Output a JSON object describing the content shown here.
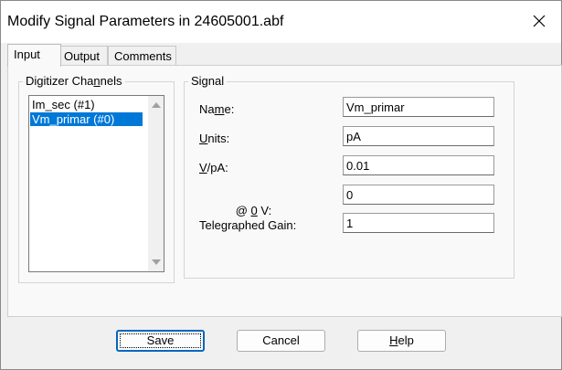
{
  "window": {
    "title": "Modify Signal Parameters in 24605001.abf",
    "close_glyph": "✕"
  },
  "tabs": [
    {
      "label": "Input",
      "active": true
    },
    {
      "label": "Output",
      "active": false
    },
    {
      "label": "Comments",
      "active": false
    }
  ],
  "channels": {
    "group_label_pre": "Digitizer Cha",
    "group_label_accel": "n",
    "group_label_post": "nels",
    "items": [
      {
        "label": "Im_sec (#1)",
        "selected": false
      },
      {
        "label": "Vm_primar (#0)",
        "selected": true
      }
    ]
  },
  "signal": {
    "group_label": "Signal",
    "name": {
      "pre": "Na",
      "accel": "m",
      "post": "e:",
      "value": "Vm_primar"
    },
    "units": {
      "pre": "",
      "accel": "U",
      "post": "nits:",
      "value": "pA"
    },
    "scale": {
      "pre": "",
      "accel": "V",
      "post": "/pA:",
      "value": "0.01"
    },
    "offset": {
      "pre": " @ ",
      "accel": "0",
      "post": " V:",
      "value": "0"
    },
    "gain": {
      "label": "Telegraphed Gain:",
      "value": "1"
    }
  },
  "buttons": {
    "save": "Save",
    "cancel": "Cancel",
    "help_accel": "H",
    "help_rest": "elp"
  }
}
